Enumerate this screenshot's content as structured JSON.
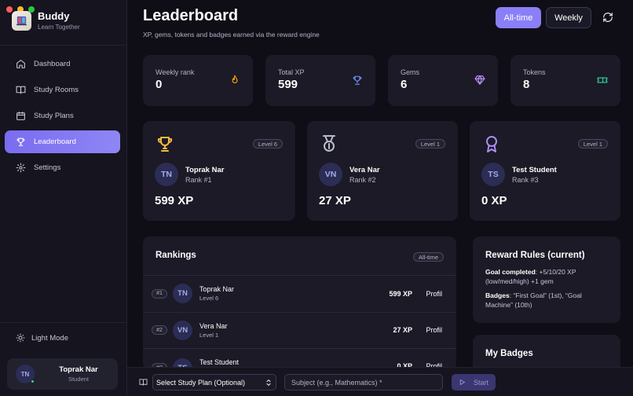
{
  "colors": {
    "accent": "#8a7ff7",
    "traffic_red": "#ff5f57",
    "traffic_yellow": "#febc2e",
    "traffic_green": "#28c840",
    "fire": "#f59e0b",
    "trophy_blue": "#6d8df5",
    "gem_purple": "#b98cf5",
    "ticket_green": "#34d399",
    "gold": "#f5b942",
    "silver": "#b9bccd",
    "bronze": "#a98cf0"
  },
  "app": {
    "name": "Buddy",
    "tagline": "Learn Together"
  },
  "sidebar": {
    "items": [
      {
        "label": "Dashboard",
        "icon": "home-icon"
      },
      {
        "label": "Study Rooms",
        "icon": "book-icon"
      },
      {
        "label": "Study Plans",
        "icon": "calendar-icon"
      },
      {
        "label": "Leaderboard",
        "icon": "trophy-icon",
        "active": true
      },
      {
        "label": "Settings",
        "icon": "gear-icon"
      }
    ],
    "light_mode_label": "Light Mode",
    "user": {
      "initials": "TN",
      "name": "Toprak Nar",
      "role": "Student"
    }
  },
  "header": {
    "title": "Leaderboard",
    "subtitle": "XP, gems, tokens and badges earned via the reward engine",
    "toggle_all_time": "All-time",
    "toggle_weekly": "Weekly"
  },
  "stats": [
    {
      "label": "Weekly rank",
      "value": "0",
      "icon": "flame-icon"
    },
    {
      "label": "Total XP",
      "value": "599",
      "icon": "trophy-icon"
    },
    {
      "label": "Gems",
      "value": "6",
      "icon": "gem-icon"
    },
    {
      "label": "Tokens",
      "value": "8",
      "icon": "ticket-icon"
    }
  ],
  "podium": [
    {
      "initials": "TN",
      "name": "Toprak Nar",
      "rank": "Rank #1",
      "level": "Level 6",
      "xp": "599 XP",
      "icon": "trophy-icon"
    },
    {
      "initials": "VN",
      "name": "Vera Nar",
      "rank": "Rank #2",
      "level": "Level 1",
      "xp": "27 XP",
      "icon": "medal-icon"
    },
    {
      "initials": "TS",
      "name": "Test Student",
      "rank": "Rank #3",
      "level": "Level 1",
      "xp": "0 XP",
      "icon": "award-icon"
    }
  ],
  "rankings": {
    "title": "Rankings",
    "filter": "All-time",
    "rows": [
      {
        "rank": "#1",
        "initials": "TN",
        "name": "Toprak Nar",
        "level": "Level 6",
        "xp": "599 XP",
        "action": "Profil"
      },
      {
        "rank": "#2",
        "initials": "VN",
        "name": "Vera Nar",
        "level": "Level 1",
        "xp": "27 XP",
        "action": "Profil"
      },
      {
        "rank": "#3",
        "initials": "TS",
        "name": "Test Student",
        "level": "",
        "xp": "0 XP",
        "action": "Profil"
      }
    ]
  },
  "rules": {
    "title": "Reward Rules (current)",
    "goal_label": "Goal completed",
    "goal_text": ": +5/10/20 XP (low/med/high) +1 gem",
    "badges_label": "Badges",
    "badges_text": ": “First Goal” (1st), “Goal Machine” (10th)"
  },
  "badges": {
    "title": "My Badges"
  },
  "bottombar": {
    "plan_select": "Select Study Plan (Optional)",
    "subject_placeholder": "Subject (e.g., Mathematics) *",
    "start_label": "Start"
  }
}
